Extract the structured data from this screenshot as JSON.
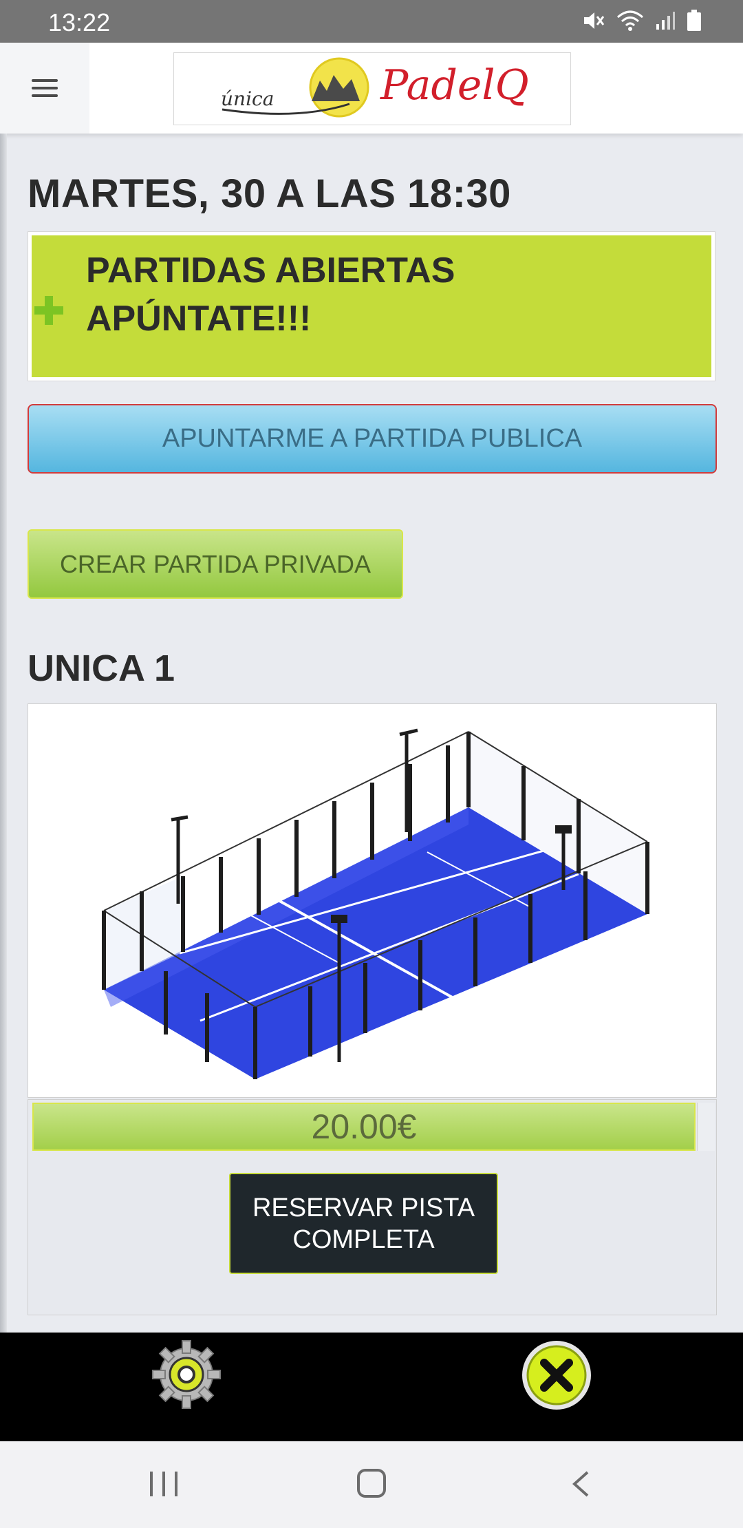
{
  "status_bar": {
    "time": "13:22",
    "icons": [
      "mute-icon",
      "wifi-icon",
      "signal-icon",
      "battery-icon"
    ]
  },
  "header": {
    "logo_text_left": "única",
    "logo_text_right": "PadelQ",
    "menu_icon": "hamburger-menu-icon"
  },
  "main": {
    "title": "MARTES, 30 A LAS 18:30",
    "open_games": {
      "line1": "PARTIDAS ABIERTAS",
      "line2": "APÚNTATE!!!"
    },
    "public_button": "APUNTARME A PARTIDA PUBLICA",
    "private_button": "CREAR PARTIDA PRIVADA",
    "court": {
      "name": "UNICA 1",
      "price": "20.00€",
      "reserve_button": "RESERVAR PISTA COMPLETA"
    }
  },
  "bottom_bar": {
    "settings_icon": "gear-icon",
    "close_icon": "close-icon"
  },
  "nav_bar": {
    "recents": "recents-icon",
    "home": "home-icon",
    "back": "back-icon"
  },
  "colors": {
    "accent_green": "#c4dc3a",
    "button_blue": "#55b6df",
    "court_blue": "#2f45e0",
    "dark_button": "#1f272c"
  }
}
